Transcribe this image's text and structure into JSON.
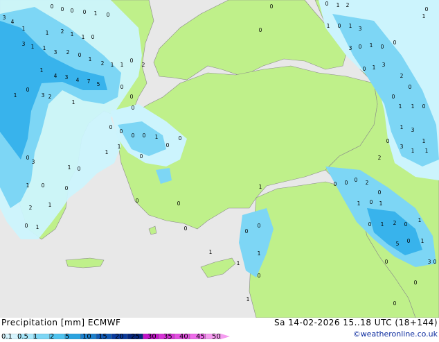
{
  "map": {
    "point_values": [
      "3",
      "4",
      "3",
      "1",
      "0",
      "0",
      "0",
      "0",
      "1",
      "0",
      "1",
      "3",
      "2",
      "0",
      "1",
      "2",
      "1",
      "1",
      "0",
      "2",
      "1",
      "1",
      "2",
      "1",
      "1",
      "0",
      "4",
      "3",
      "4",
      "7",
      "5",
      "1",
      "3",
      "2",
      "0",
      "1",
      "0",
      "0",
      "1",
      "0",
      "0",
      "0",
      "0",
      "0",
      "1",
      "0",
      "0",
      "0",
      "1",
      "1",
      "0",
      "3",
      "1",
      "0",
      "2",
      "1",
      "0",
      "1",
      "0",
      "0",
      "1",
      "0",
      "0",
      "0",
      "1",
      "1",
      "0",
      "0",
      "1",
      "0",
      "1",
      "1",
      "0",
      "0",
      "0",
      "1",
      "2",
      "0",
      "1",
      "0",
      "1",
      "0",
      "1",
      "3",
      "3",
      "0",
      "1",
      "0",
      "0",
      "1",
      "3",
      "2",
      "0",
      "0",
      "1",
      "1",
      "0",
      "1",
      "3",
      "1",
      "0",
      "3",
      "1",
      "1",
      "2",
      "0",
      "0",
      "0",
      "2",
      "1",
      "0",
      "1",
      "0",
      "1",
      "2",
      "0",
      "1",
      "5",
      "0",
      "1",
      "0",
      "0",
      "0",
      "0",
      "3",
      "0"
    ]
  },
  "footer": {
    "title_left": "Precipitation [mm] ECMWF",
    "title_right": "Sa 14-02-2026 15..18 UTC (18+144)",
    "credit": "©weatheronline.co.uk"
  },
  "legend": {
    "ticks": [
      "0.1",
      "0.5",
      "1",
      "2",
      "5",
      "10",
      "15",
      "20",
      "25",
      "30",
      "35",
      "40",
      "45",
      "50"
    ],
    "colors": [
      "#d6f5ff",
      "#a8e8fc",
      "#7dd6f5",
      "#4fc3ef",
      "#2aa3e0",
      "#1c7fcc",
      "#1159b3",
      "#0a3a9c",
      "#06257a",
      "#c215c9",
      "#d633d6",
      "#e34fe0",
      "#ee6cea",
      "#f59cf0"
    ]
  },
  "colors": {
    "land": "#bff08a",
    "sea": "#e8e8e8",
    "precip_light": "#ccf4fd",
    "precip_mid": "#7dd6f5",
    "precip_strong": "#38b3ec",
    "precip_heavy": "#1c88d6"
  }
}
